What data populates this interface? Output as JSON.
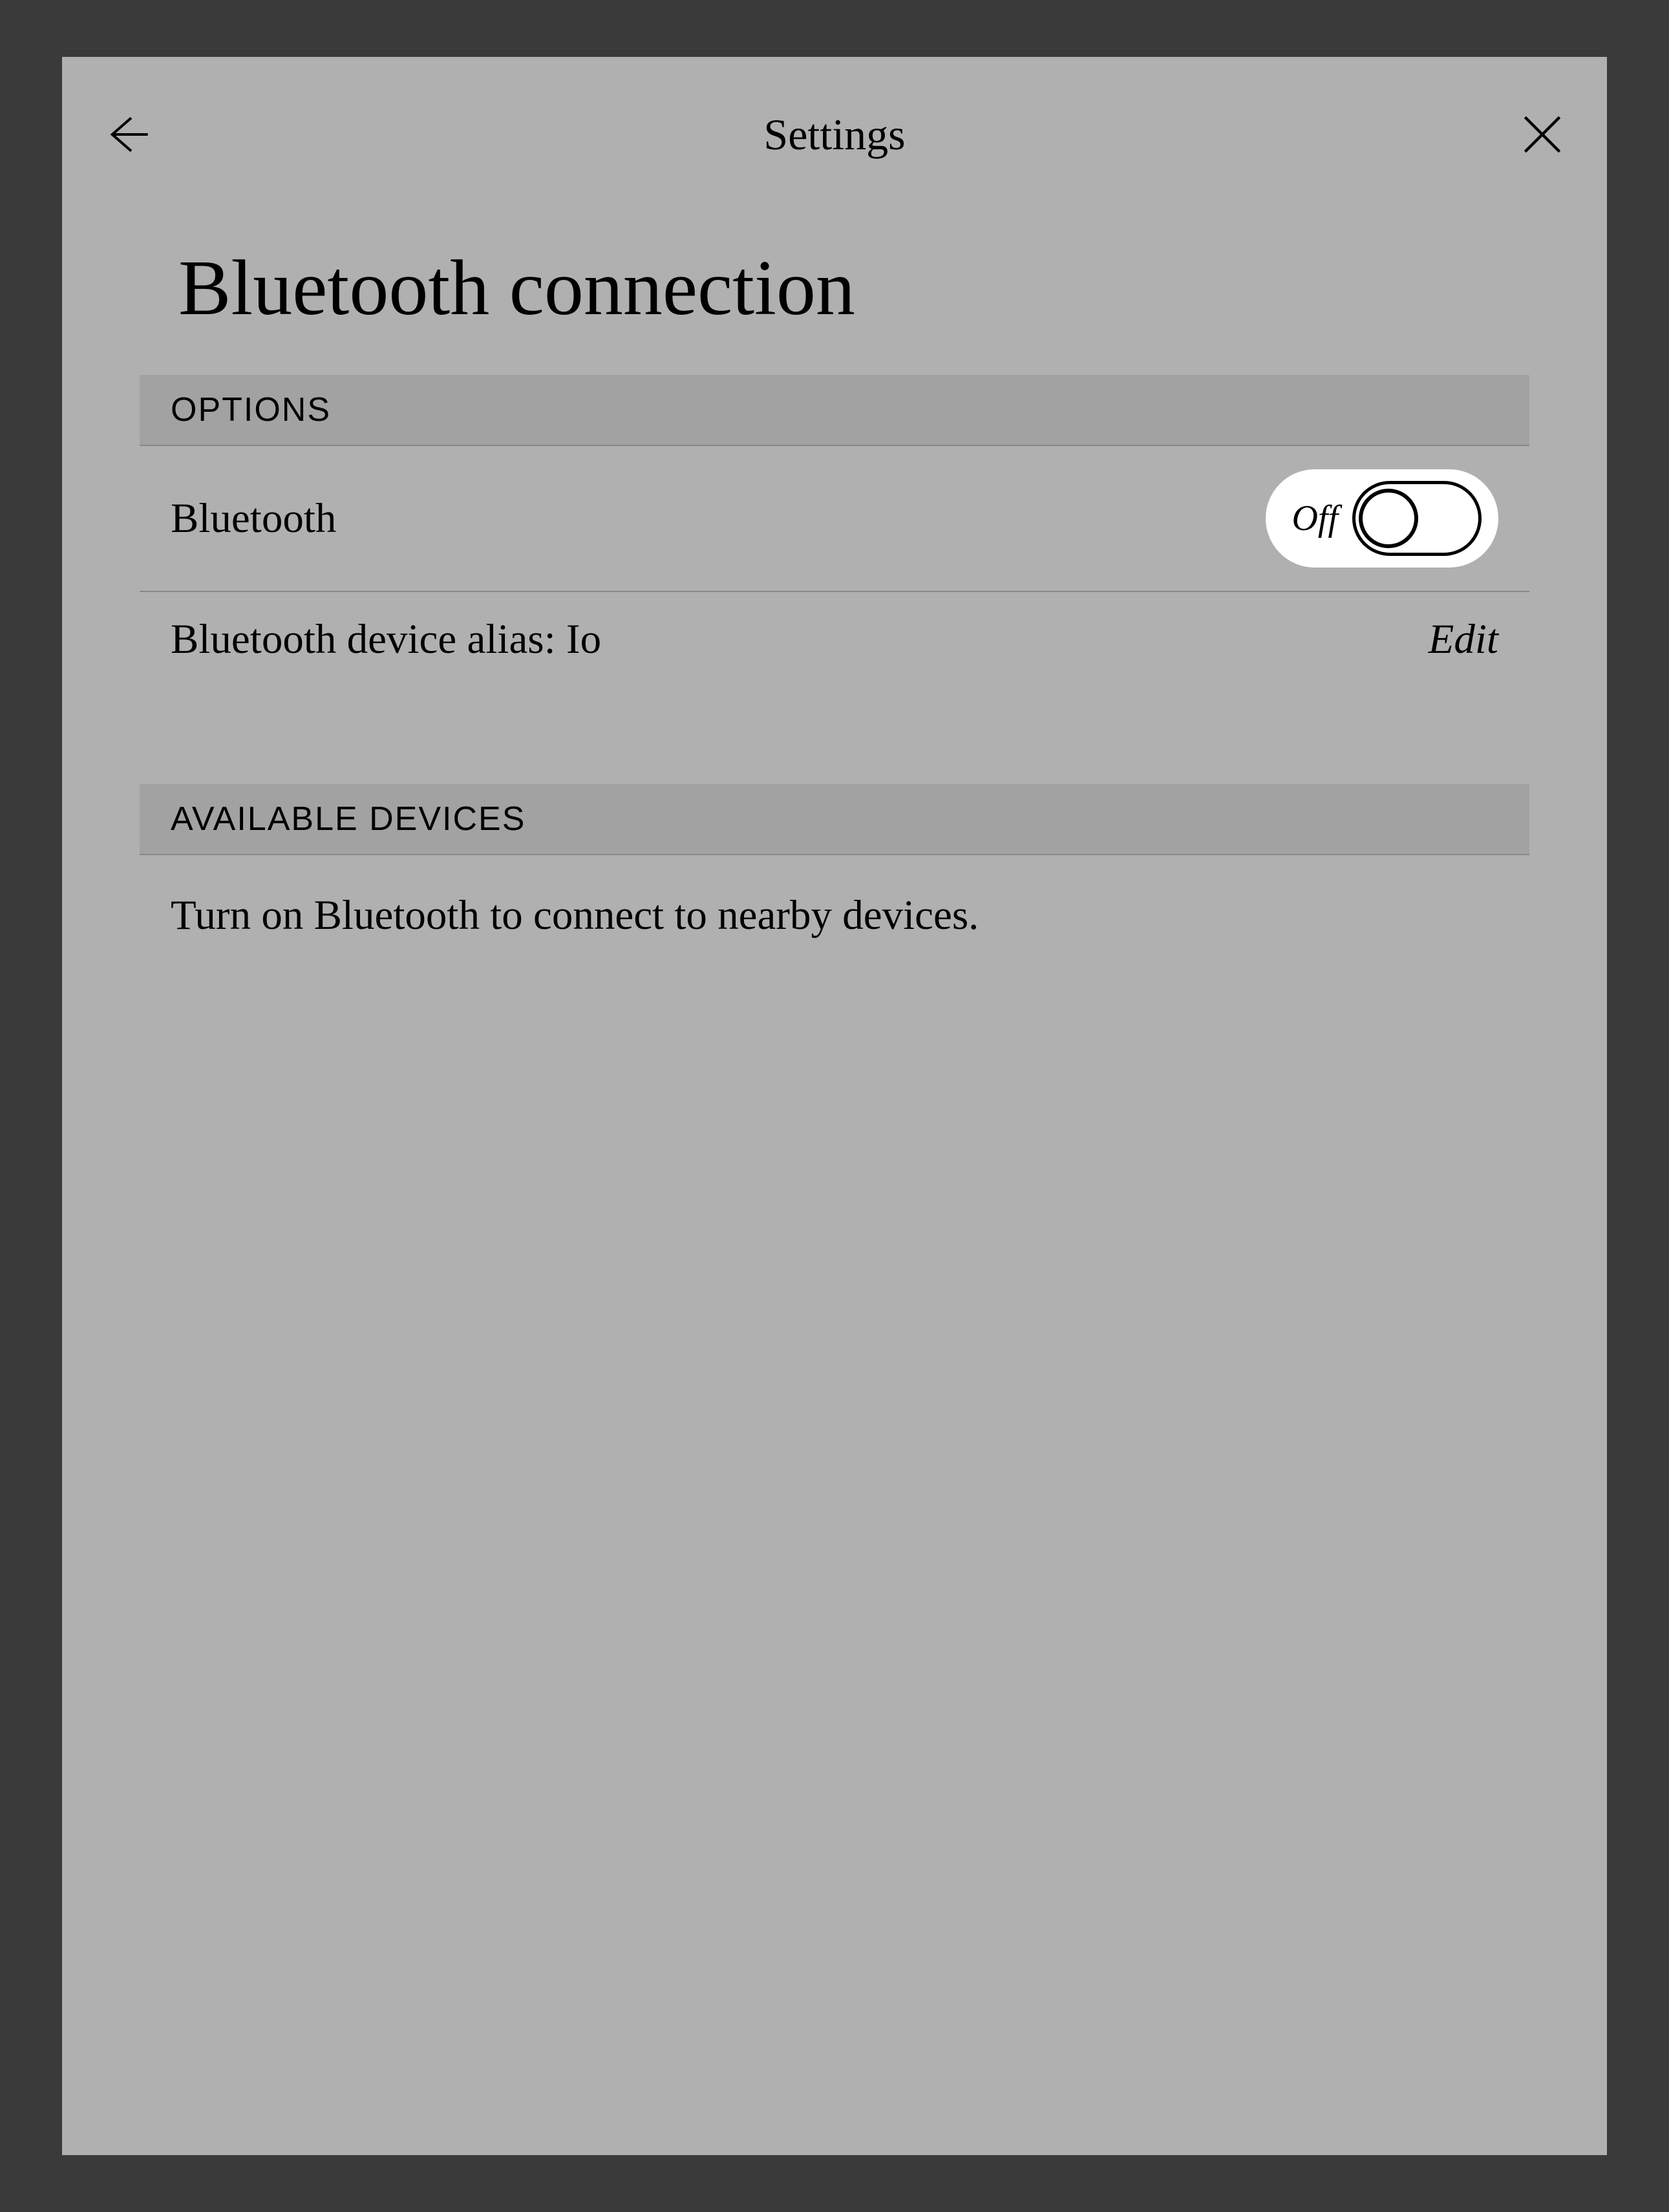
{
  "header": {
    "title": "Settings"
  },
  "page": {
    "title": "Bluetooth connection"
  },
  "sections": {
    "options": {
      "header": "OPTIONS",
      "bluetooth": {
        "label": "Bluetooth",
        "toggle_state": "Off"
      },
      "alias": {
        "prefix": "Bluetooth device alias: ",
        "value": "Io",
        "edit_label": "Edit"
      }
    },
    "devices": {
      "header": "AVAILABLE DEVICES",
      "status": "Turn on Bluetooth to connect to nearby devices."
    }
  }
}
